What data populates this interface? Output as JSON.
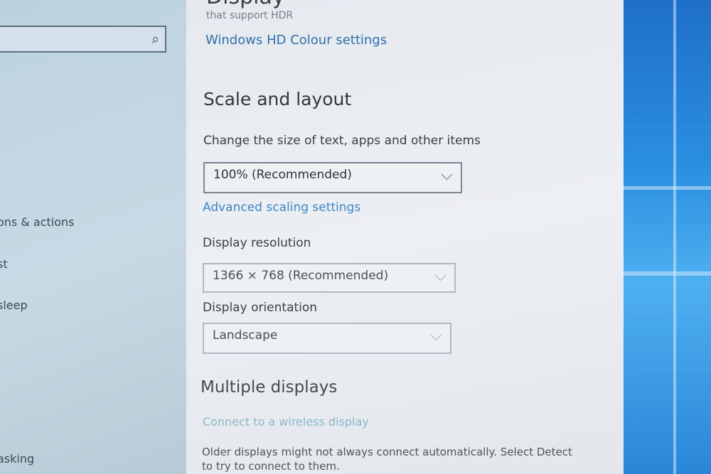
{
  "nav": {
    "search_icon": "search-icon",
    "items": [
      "ons & actions",
      "st",
      "sleep",
      "asking"
    ]
  },
  "main": {
    "display_title": "Display",
    "hdr_text": "that support HDR",
    "hd_colour_link": "Windows HD Colour settings",
    "scale_section": "Scale and layout",
    "scale_label": "Change the size of text, apps and other items",
    "scale_value": "100% (Recommended)",
    "advanced_link": "Advanced scaling settings",
    "resolution_label": "Display resolution",
    "resolution_value": "1366 × 768 (Recommended)",
    "orientation_label": "Display orientation",
    "orientation_value": "Landscape",
    "multiple_section": "Multiple displays",
    "wireless_link": "Connect to a wireless display",
    "note_line1": "Older displays might not always connect automatically. Select Detect",
    "note_line2": "to try to connect to them."
  },
  "colors": {
    "link": "#2f6fb0",
    "accent_desktop": "#2a8fe0"
  }
}
